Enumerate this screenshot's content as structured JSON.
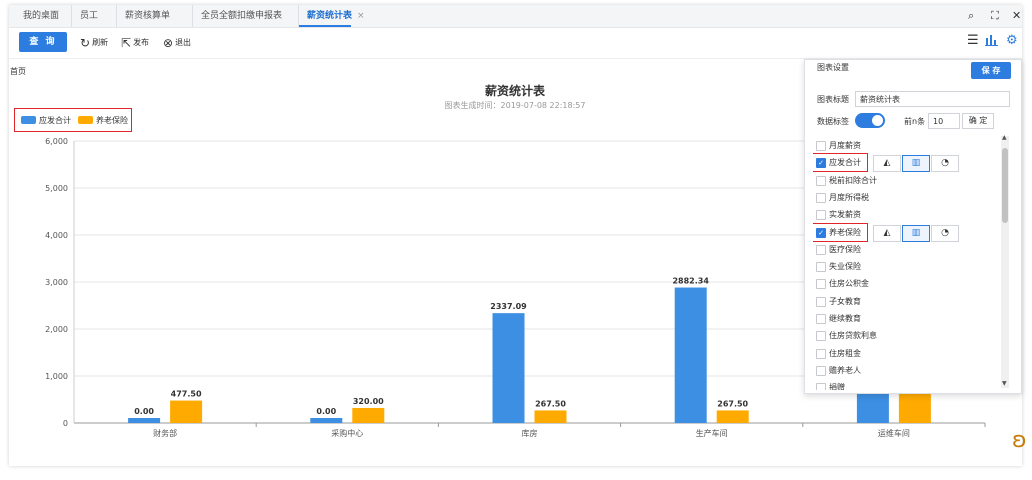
{
  "tabs": [
    {
      "label": "我的桌面"
    },
    {
      "label": "员工"
    },
    {
      "label": "薪资核算单"
    },
    {
      "label": "全员全额扣缴申报表"
    },
    {
      "label": "薪资统计表",
      "close": "×"
    }
  ],
  "toolbar": {
    "query": "查 询",
    "refresh": "刷新",
    "publish": "发布",
    "exit": "退出"
  },
  "icons": {
    "tab_right": [
      "search-icon",
      "expand-icon",
      "close-icon"
    ],
    "toolbar_right": [
      "list-icon",
      "bar-chart-icon",
      "gear-icon"
    ]
  },
  "breadcrumb": "首页",
  "chart_data": {
    "type": "bar",
    "title": "薪资统计表",
    "subtitle": "图表生成时间：2019-07-08 22:18:57",
    "categories": [
      "财务部",
      "采购中心",
      "库房",
      "生产车间",
      "运维车间"
    ],
    "series": [
      {
        "name": "应发合计",
        "color": "#3d8fe3",
        "values": [
          0.0,
          0.0,
          2337.09,
          2882.34,
          null
        ],
        "labels": [
          "0.00",
          "0.00",
          "2337.09",
          "2882.34",
          ""
        ]
      },
      {
        "name": "养老保险",
        "color": "#ffaa00",
        "values": [
          477.5,
          320.0,
          267.5,
          267.5,
          null
        ],
        "labels": [
          "477.50",
          "320.00",
          "267.50",
          "267.50",
          ""
        ]
      }
    ],
    "ylim": [
      0,
      6000
    ],
    "yticks": [
      "0",
      "1,000",
      "2,000",
      "3,000",
      "4,000",
      "5,000",
      "6,000"
    ],
    "grid": true,
    "legend": "top-left"
  },
  "panel": {
    "title": "图表设置",
    "save": "保 存",
    "title_label": "图表标题",
    "title_value": "薪资统计表",
    "data_label": "数据标签",
    "topn_label": "前n条",
    "topn_value": "10",
    "confirm": "确 定",
    "items": [
      {
        "label": "月度薪资",
        "checked": false
      },
      {
        "label": "应发合计",
        "checked": true
      },
      {
        "label": "税前扣除合计",
        "checked": false
      },
      {
        "label": "月度所得税",
        "checked": false
      },
      {
        "label": "实发薪资",
        "checked": false
      },
      {
        "label": "养老保险",
        "checked": true
      },
      {
        "label": "医疗保险",
        "checked": false
      },
      {
        "label": "失业保险",
        "checked": false
      },
      {
        "label": "住房公积金",
        "checked": false
      },
      {
        "label": "子女教育",
        "checked": false
      },
      {
        "label": "继续教育",
        "checked": false
      },
      {
        "label": "住房贷款利息",
        "checked": false
      },
      {
        "label": "住房租金",
        "checked": false
      },
      {
        "label": "赡养老人",
        "checked": false
      },
      {
        "label": "捐赠",
        "checked": false
      }
    ],
    "chart_types": [
      "area-chart-icon",
      "bar-chart-icon",
      "pie-chart-icon"
    ]
  }
}
